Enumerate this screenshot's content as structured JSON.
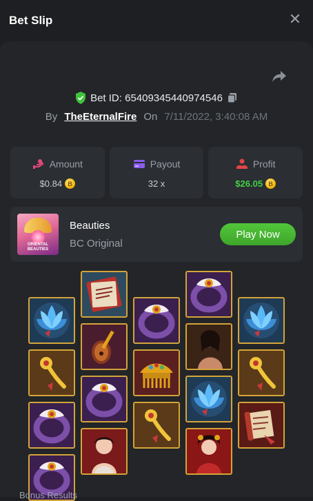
{
  "header": {
    "title": "Bet Slip",
    "close_icon": "close-icon"
  },
  "bet": {
    "id_label": "Bet ID: 65409345440974546",
    "by_label": "By",
    "user": "TheEternalFire",
    "on_label": "On",
    "datetime": "7/11/2022, 3:40:08 AM"
  },
  "stats": [
    {
      "label": "Amount",
      "value": "$0.84",
      "icon": "amount-icon",
      "coin": true
    },
    {
      "label": "Payout",
      "value": "32 x",
      "icon": "payout-icon",
      "coin": false
    },
    {
      "label": "Profit",
      "value": "$26.05",
      "icon": "profit-icon",
      "coin": true
    }
  ],
  "game": {
    "name": "Beauties",
    "provider": "BC Original",
    "play_label": "Play Now",
    "thumb_text": "ORIENTAL BEAUTIES"
  },
  "reels": [
    [
      "lotus",
      "hairpin",
      "ring",
      "ring"
    ],
    [
      "book",
      "pipa",
      "ring",
      "lady1"
    ],
    [
      "ring",
      "comb",
      "hairpin"
    ],
    [
      "ring",
      "lady2",
      "lotus",
      "lady3"
    ],
    [
      "lotus",
      "hairpin",
      "scroll"
    ]
  ],
  "footer": {
    "text": "Bonus Results"
  },
  "colors": {
    "green": "#43d046",
    "accent_green": "#3ea62b",
    "gold_border": "#d4a53a"
  }
}
